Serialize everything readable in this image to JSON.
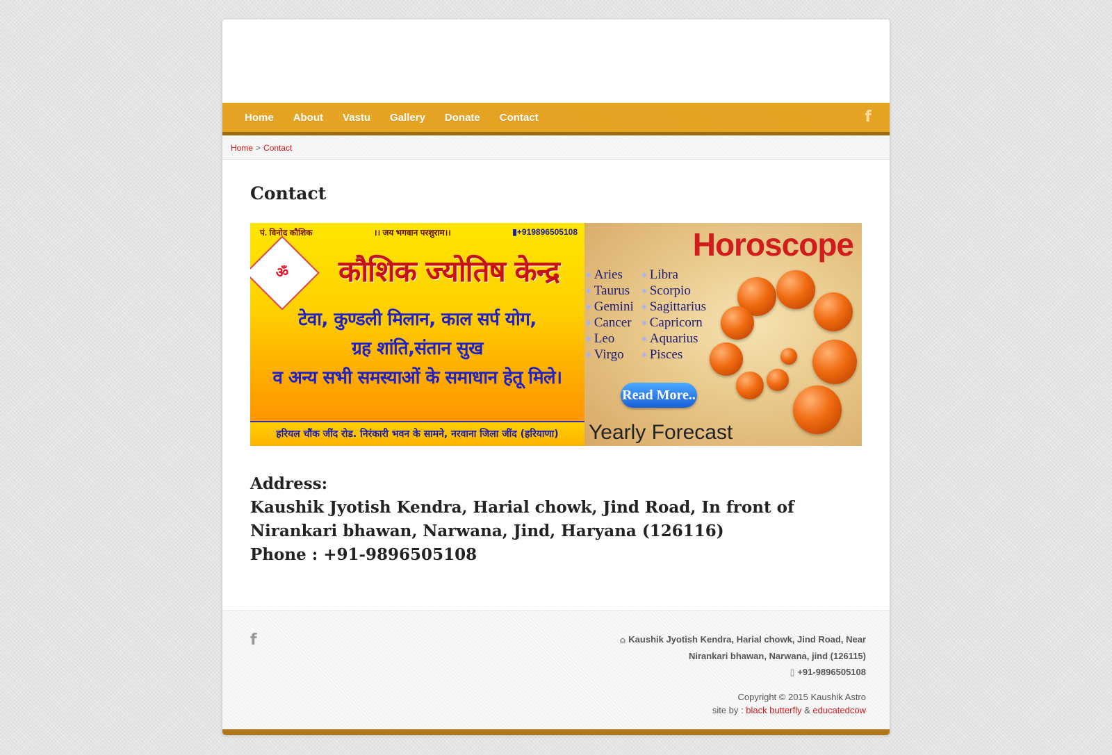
{
  "nav": {
    "items": [
      {
        "label": "Home"
      },
      {
        "label": "About"
      },
      {
        "label": "Vastu"
      },
      {
        "label": "Gallery"
      },
      {
        "label": "Donate"
      },
      {
        "label": "Contact"
      }
    ],
    "facebook_icon": "facebook-icon"
  },
  "breadcrumb": {
    "home": "Home",
    "separator": ">",
    "current": "Contact"
  },
  "page": {
    "title": "Contact"
  },
  "banner": {
    "left": {
      "name": "पं. विनोद कौशिक",
      "jai": "।। जय भगवान परशुराम।।",
      "phone": "+919896505108",
      "title": "कौशिक ज्योतिष केन्द्र",
      "line1": "टेवा, कुण्डली मिलान, काल सर्प योग,",
      "line2": "ग्रह शांति,संतान सुख",
      "line3": "व अन्य सभी समस्याओं के समाधान हेतू मिले।",
      "address": "हरियल चौंक जींद रोड. निरंकारी भवन के सामने, नरवाना जिला जींद (हरियाणा)",
      "chakra_symbol": "ॐ"
    },
    "right": {
      "title": "Horoscope",
      "signs": [
        "Aries",
        "Libra",
        "Taurus",
        "Scorpio",
        "Gemini",
        "Sagittarius",
        "Cancer",
        "Capricorn",
        "Leo",
        "Aquarius",
        "Virgo",
        "Pisces"
      ],
      "read_more": "Read More..",
      "forecast": "Yearly Forecast"
    }
  },
  "contact": {
    "address_label": "Address:",
    "address_line1": "Kaushik Jyotish Kendra, Harial chowk, Jind Road, In front of",
    "address_line2": "Nirankari bhawan, Narwana, Jind, Haryana (126116)",
    "phone": "Phone : +91-9896505108"
  },
  "footer": {
    "address_line1": "Kaushik Jyotish Kendra, Harial chowk, Jind Road, Near",
    "address_line2": "Nirankari bhawan, Narwana, jind (126115)",
    "phone": "+91-9896505108",
    "copyright": "Copyright © 2015 Kaushik Astro",
    "site_by": "site by :",
    "link1": "black butterfly",
    "amp": "&",
    "link2": "educatedcow"
  },
  "colors": {
    "nav_bg": "#e4a11d",
    "nav_border": "#9a6a14",
    "link_red": "#d01818",
    "bottom_bar": "#b0781a"
  }
}
